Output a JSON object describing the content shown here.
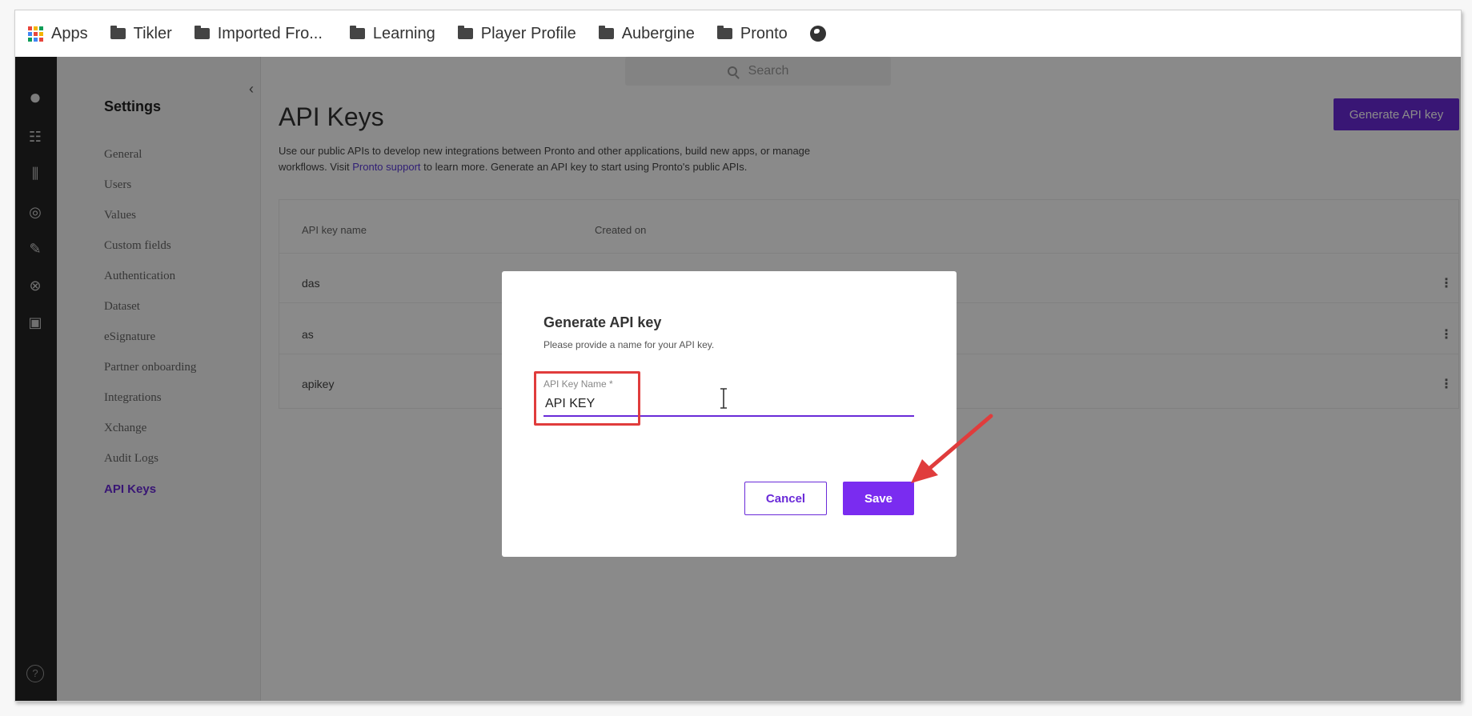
{
  "bookmarks": {
    "apps_label": "Apps",
    "items": [
      "Tikler",
      "Imported Fro...",
      "Learning",
      "Player Profile",
      "Aubergine",
      "Pronto"
    ]
  },
  "colors": {
    "accent": "#6a2ad8",
    "highlight": "#e03c3c",
    "apps_grid": [
      "#e8453c",
      "#f4b400",
      "#0f9d58",
      "#4285f4",
      "#e8453c",
      "#f4b400",
      "#0f9d58",
      "#4285f4",
      "#e8453c"
    ]
  },
  "search": {
    "placeholder": "Search"
  },
  "settings": {
    "title": "Settings",
    "items": [
      "General",
      "Users",
      "Values",
      "Custom fields",
      "Authentication",
      "Dataset",
      "eSignature",
      "Partner onboarding",
      "Integrations",
      "Xchange",
      "Audit Logs",
      "API Keys"
    ],
    "active": "API Keys"
  },
  "page": {
    "title": "API Keys",
    "desc_part1": "Use our public APIs to develop new integrations between Pronto and other applications, build new apps, or manage workflows. Visit ",
    "desc_link": "Pronto support",
    "desc_part2": " to learn more. Generate an API key to start using Pronto's public APIs.",
    "generate_button": "Generate API key"
  },
  "table": {
    "headers": [
      "API key name",
      "Created on"
    ],
    "rows": [
      {
        "name": "das"
      },
      {
        "name": "as"
      },
      {
        "name": "apikey"
      }
    ]
  },
  "modal": {
    "title": "Generate API key",
    "subtitle": "Please provide a name for your API key.",
    "field_label": "API Key Name *",
    "field_value": "API KEY",
    "cancel": "Cancel",
    "save": "Save"
  }
}
